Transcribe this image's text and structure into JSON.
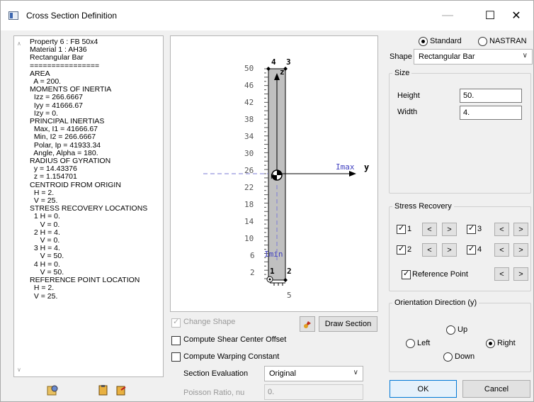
{
  "window": {
    "title": "Cross Section Definition"
  },
  "properties": {
    "lines": [
      "Property 6 : FB 50x4",
      "Material 1 : AH36",
      "Rectangular Bar",
      "================",
      "AREA",
      "  A = 200.",
      "MOMENTS OF INERTIA",
      "  Izz = 266.6667",
      "  Iyy = 41666.67",
      "  Izy = 0.",
      "PRINCIPAL INERTIAS",
      "  Max, I1 = 41666.67",
      "  Min, I2 = 266.6667",
      "  Polar, Ip = 41933.34",
      "  Angle, Alpha = 180.",
      "RADIUS OF GYRATION",
      "  y = 14.43376",
      "  z = 1.154701",
      "CENTROID FROM ORIGIN",
      "  H = 2.",
      "  V = 25.",
      "STRESS RECOVERY LOCATIONS",
      "  1 H = 0.",
      "     V = 0.",
      "  2 H = 4.",
      "     V = 0.",
      "  3 H = 4.",
      "     V = 50.",
      "  4 H = 0.",
      "     V = 50.",
      "REFERENCE POINT LOCATION",
      "  H = 2.",
      "  V = 25."
    ]
  },
  "plot": {
    "ticks": [
      "50",
      "46",
      "42",
      "38",
      "34",
      "30",
      "26",
      "22",
      "18",
      "14",
      "10",
      "6",
      "2"
    ],
    "corner_labels": {
      "c1": "1",
      "c2": "2",
      "c3": "3",
      "c4": "4",
      "z": "z",
      "p": "P",
      "five": "5"
    },
    "axis_labels": {
      "imax": "Imax",
      "y": "y",
      "imin": "Imin"
    }
  },
  "options": {
    "change_shape": "Change Shape",
    "draw_section": "Draw Section",
    "compute_shear": "Compute Shear Center Offset",
    "compute_warping": "Compute Warping Constant",
    "section_eval_label": "Section Evaluation",
    "section_eval_value": "Original",
    "poisson_label": "Poisson Ratio, nu",
    "poisson_value": "0."
  },
  "right": {
    "standard": "Standard",
    "nastran": "NASTRAN",
    "shape_label": "Shape",
    "shape_value": "Rectangular Bar",
    "size_title": "Size",
    "height_label": "Height",
    "height_value": "50.",
    "width_label": "Width",
    "width_value": "4.",
    "stress_title": "Stress Recovery",
    "sr": [
      "1",
      "2",
      "3",
      "4"
    ],
    "lt": "<",
    "gt": ">",
    "reference_point": "Reference Point",
    "orient_title": "Orientation Direction (y)",
    "up": "Up",
    "left": "Left",
    "right": "Right",
    "down": "Down",
    "ok": "OK",
    "cancel": "Cancel"
  },
  "colors": {
    "section_fill": "#c0c0c0",
    "axis_dash": "#7b7bd6"
  }
}
